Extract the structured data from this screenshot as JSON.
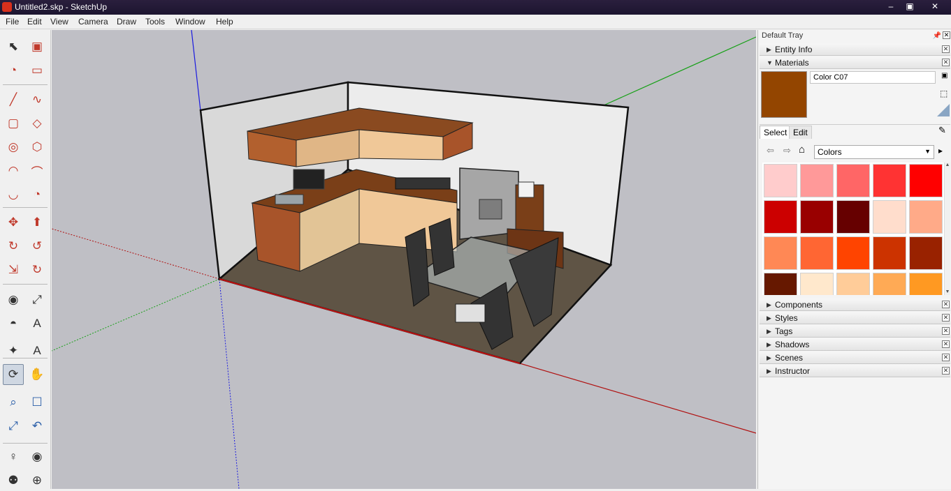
{
  "window": {
    "title": "Untitled2.skp - SketchUp"
  },
  "menu": [
    "File",
    "Edit",
    "View",
    "Camera",
    "Draw",
    "Tools",
    "Window",
    "Help"
  ],
  "tools": [
    {
      "name": "select-tool-icon",
      "active": false
    },
    {
      "name": "make-component-icon",
      "active": false
    },
    {
      "name": "paint-bucket-icon",
      "active": false
    },
    {
      "name": "eraser-icon",
      "active": false
    },
    {
      "name": "line-tool-icon",
      "active": false
    },
    {
      "name": "freehand-tool-icon",
      "active": false
    },
    {
      "name": "rectangle-tool-icon",
      "active": false
    },
    {
      "name": "rotated-rectangle-icon",
      "active": false
    },
    {
      "name": "circle-tool-icon",
      "active": false
    },
    {
      "name": "polygon-tool-icon",
      "active": false
    },
    {
      "name": "arc-tool-icon",
      "active": false
    },
    {
      "name": "two-point-arc-icon",
      "active": false
    },
    {
      "name": "three-point-arc-icon",
      "active": false
    },
    {
      "name": "pie-tool-icon",
      "active": false
    },
    {
      "name": "move-tool-icon",
      "active": false
    },
    {
      "name": "push-pull-icon",
      "active": false
    },
    {
      "name": "rotate-tool-icon",
      "active": false
    },
    {
      "name": "follow-me-icon",
      "active": false
    },
    {
      "name": "scale-tool-icon",
      "active": false
    },
    {
      "name": "offset-tool-icon",
      "active": false
    },
    {
      "name": "tape-measure-icon",
      "active": false
    },
    {
      "name": "dimension-tool-icon",
      "active": false
    },
    {
      "name": "protractor-icon",
      "active": false
    },
    {
      "name": "text-tool-icon",
      "active": false
    },
    {
      "name": "axes-tool-icon",
      "active": false
    },
    {
      "name": "3d-text-icon",
      "active": false
    },
    {
      "name": "orbit-tool-icon",
      "active": true
    },
    {
      "name": "pan-tool-icon",
      "active": false
    },
    {
      "name": "zoom-tool-icon",
      "active": false
    },
    {
      "name": "zoom-window-icon",
      "active": false
    },
    {
      "name": "zoom-extents-icon",
      "active": false
    },
    {
      "name": "previous-view-icon",
      "active": false
    },
    {
      "name": "position-camera-icon",
      "active": false
    },
    {
      "name": "look-around-icon",
      "active": false
    },
    {
      "name": "walk-tool-icon",
      "active": false
    },
    {
      "name": "section-plane-icon",
      "active": false
    }
  ],
  "tray": {
    "title": "Default Tray",
    "panels_top": [
      {
        "label": "Entity Info",
        "expanded": false
      },
      {
        "label": "Materials",
        "expanded": true
      }
    ],
    "materials": {
      "current_name": "Color C07",
      "current_color": "#934500",
      "tabs": [
        "Select",
        "Edit"
      ],
      "library": "Colors",
      "swatches": [
        "#ffcccc",
        "#ff9999",
        "#ff6666",
        "#ff3333",
        "#ff0000",
        "#cc0000",
        "#990000",
        "#660000",
        "#ffddcc",
        "#ffaa88",
        "#ff8855",
        "#ff6633",
        "#ff4400",
        "#cc3300",
        "#992200",
        "#661800",
        "#ffe8cc",
        "#ffcc99",
        "#ffaa55",
        "#ff9922"
      ]
    },
    "panels_bottom": [
      "Components",
      "Styles",
      "Tags",
      "Shadows",
      "Scenes",
      "Instructor"
    ]
  }
}
